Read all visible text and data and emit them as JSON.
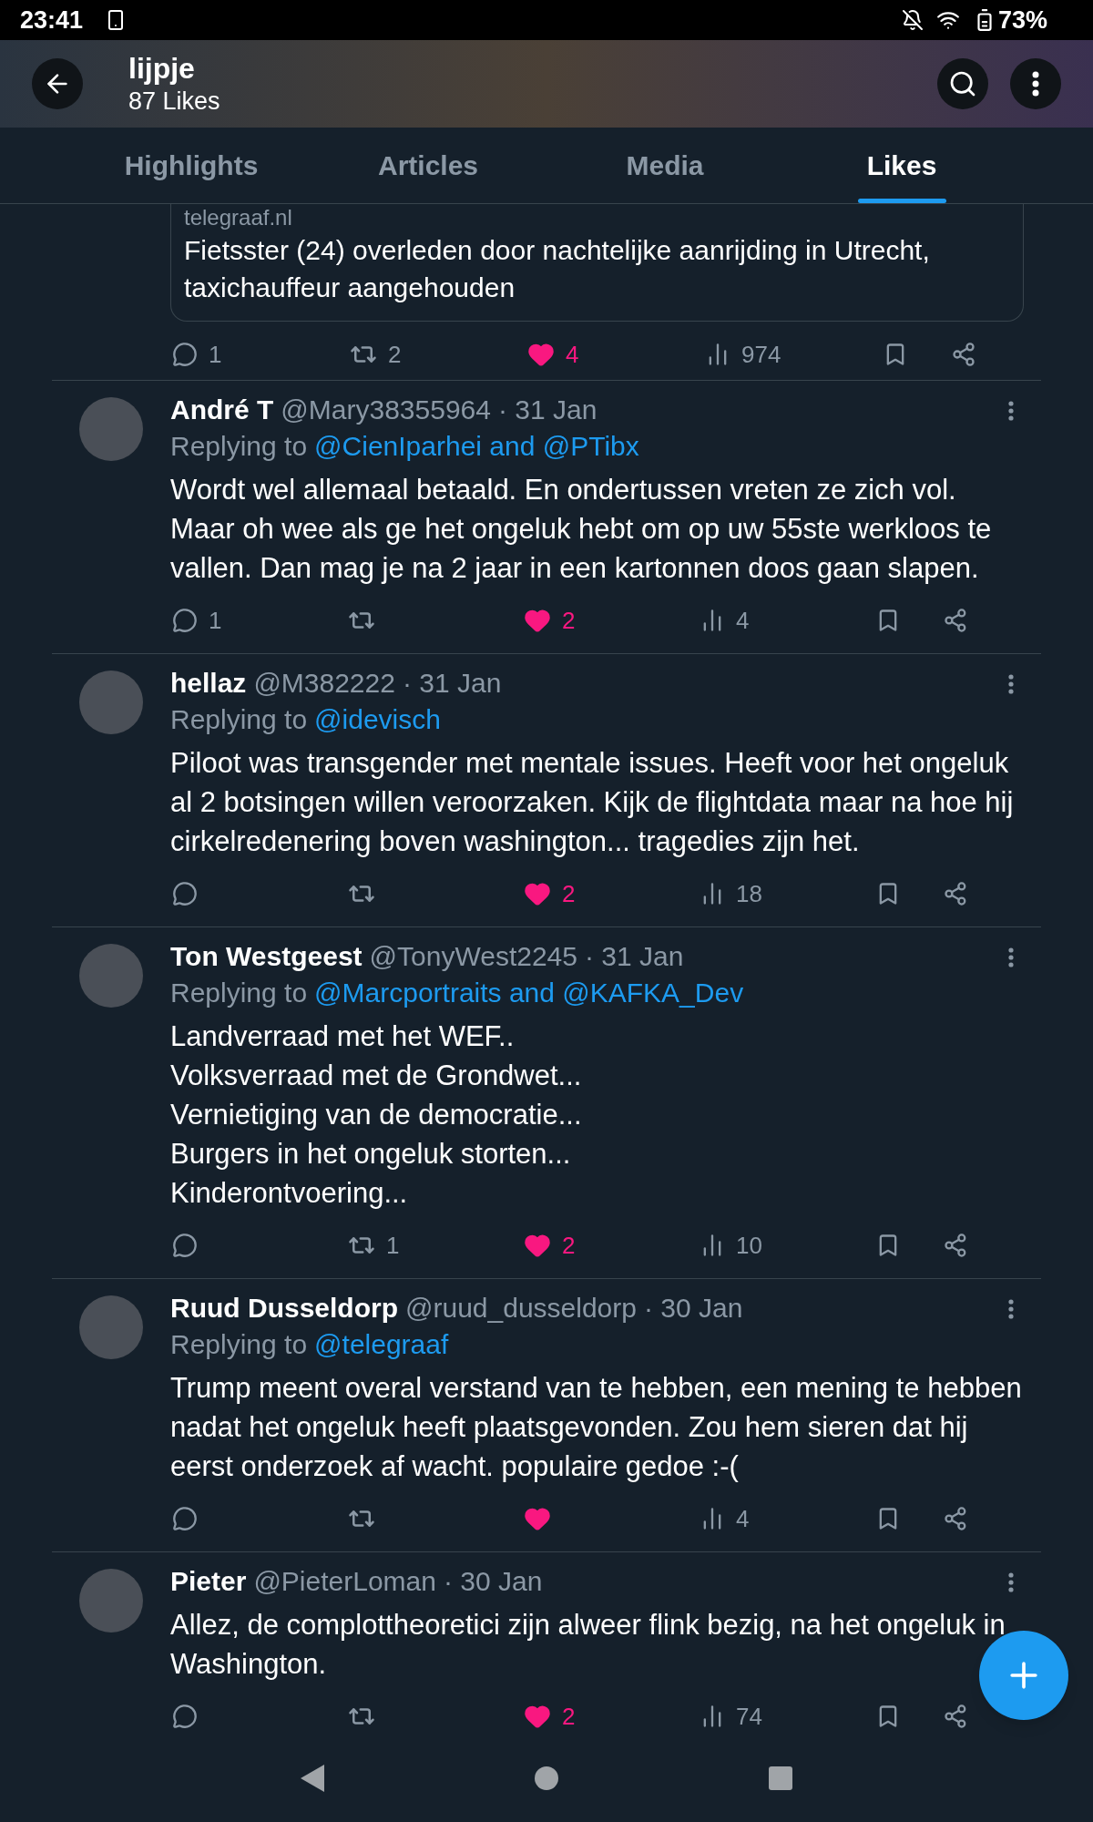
{
  "status_bar": {
    "time": "23:41",
    "battery": "73%"
  },
  "header": {
    "title": "lijpje",
    "subtitle": "87 Likes"
  },
  "tabs": [
    {
      "label": "Highlights",
      "selected": false
    },
    {
      "label": "Articles",
      "selected": false
    },
    {
      "label": "Media",
      "selected": false
    },
    {
      "label": "Likes",
      "selected": true
    }
  ],
  "first_post": {
    "card": {
      "domain": "telegraaf.nl",
      "headline": "Fietsster (24) overleden door nachtelijke aanrijding in Utrecht, taxichauffeur aangehouden"
    },
    "stats": {
      "replies": "1",
      "reposts": "2",
      "likes": "4",
      "views": "974",
      "liked": true
    }
  },
  "posts": [
    {
      "name": "André T",
      "handle": "@Mary38355964",
      "date": "· 31 Jan",
      "replying_label": "Replying to",
      "replying_to": "@CienIparhei and @PTibx",
      "body": "Wordt wel allemaal betaald. En ondertussen vreten ze zich vol. Maar oh wee als ge het ongeluk hebt om op uw 55ste werkloos te vallen. Dan mag je na 2 jaar in een kartonnen doos gaan slapen.",
      "stats": {
        "replies": "1",
        "likes": "2",
        "views": "4",
        "liked": true
      }
    },
    {
      "name": "hellaz",
      "handle": "@M382222",
      "date": "· 31 Jan",
      "replying_label": "Replying to",
      "replying_to": "@idevisch",
      "body": "Piloot was transgender met mentale issues. Heeft voor het ongeluk al 2 botsingen willen veroorzaken. Kijk de flightdata maar na hoe hij cirkelredenering boven washington... tragedies zijn het.",
      "stats": {
        "likes": "2",
        "views": "18",
        "liked": true
      }
    },
    {
      "name": "Ton Westgeest",
      "handle": "@TonyWest2245",
      "date": "· 31 Jan",
      "replying_label": "Replying to",
      "replying_to": "@Marcportraits and @KAFKA_Dev",
      "body_lines": [
        "Landverraad met het WEF..",
        "Volksverraad met de Grondwet...",
        "Vernietiging van de democratie...",
        "Burgers in het ongeluk storten...",
        "Kinderontvoering..."
      ],
      "stats": {
        "reposts": "1",
        "likes": "2",
        "views": "10",
        "liked": true
      }
    },
    {
      "name": "Ruud Dusseldorp",
      "handle": "@ruud_dusseldorp",
      "date": "· 30 Jan",
      "replying_label": "Replying to",
      "replying_to": "@telegraaf",
      "body": "Trump meent overal verstand van te hebben, een mening te hebben nadat het ongeluk heeft plaatsgevonden. Zou hem sieren dat hij eerst onderzoek af wacht. populaire gedoe :-(",
      "stats": {
        "views": "4",
        "liked": true
      }
    },
    {
      "name": "Pieter",
      "handle": "@PieterLoman",
      "date": "· 30 Jan",
      "body": "Allez, de complottheoretici zijn alweer flink bezig, na het ongeluk in Washington.",
      "stats": {
        "likes": "2",
        "views": "74",
        "liked": true
      }
    }
  ]
}
